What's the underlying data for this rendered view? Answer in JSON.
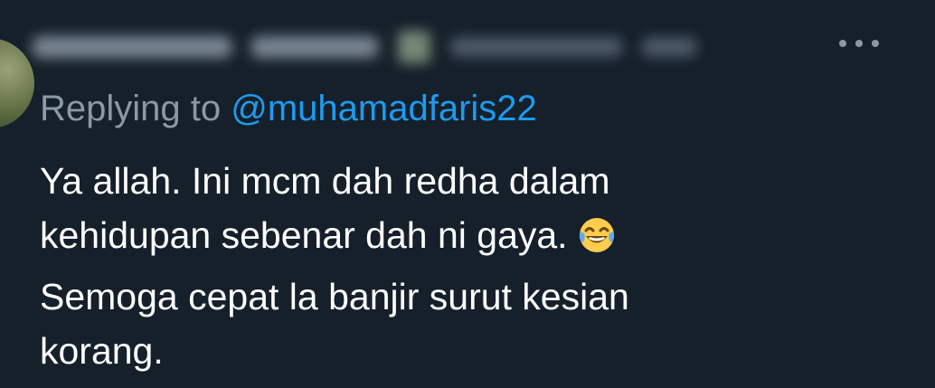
{
  "reply": {
    "prefix": "Replying to",
    "handle": "@muhamadfaris22"
  },
  "tweet": {
    "lines": [
      "Ya allah. Ini mcm dah redha dalam",
      "kehidupan sebenar dah ni gaya.",
      "Semoga cepat la banjir surut kesian",
      "korang."
    ],
    "emoji": "face-with-tears-of-joy"
  },
  "icons": {
    "more": "more-horizontal-icon"
  },
  "colors": {
    "background": "#15202b",
    "muted": "#8b98a5",
    "link": "#1d9bf0",
    "text": "#ffffff"
  }
}
